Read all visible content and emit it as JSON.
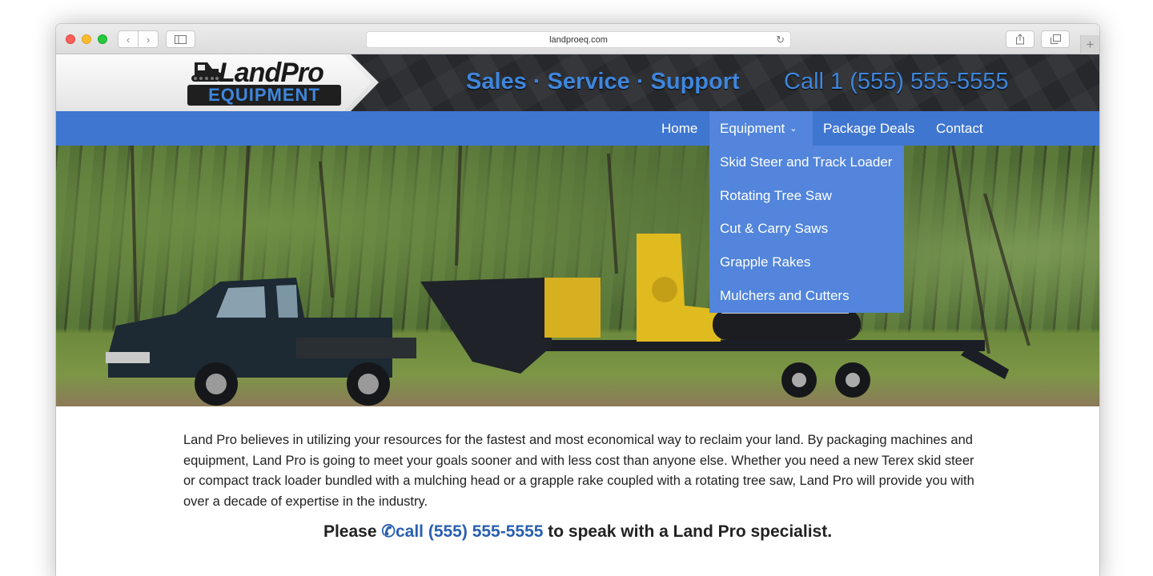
{
  "browser": {
    "url": "landproeq.com"
  },
  "header": {
    "logo_main": "LandPro",
    "logo_sub": "EQUIPMENT",
    "tagline": "Sales · Service · Support",
    "phone": "Call 1 (555) 555-5555"
  },
  "nav": {
    "items": [
      {
        "label": "Home"
      },
      {
        "label": "Equipment"
      },
      {
        "label": "Package Deals"
      },
      {
        "label": "Contact"
      }
    ],
    "dropdown": [
      {
        "label": "Skid Steer and Track Loader"
      },
      {
        "label": "Rotating Tree Saw"
      },
      {
        "label": "Cut & Carry Saws"
      },
      {
        "label": "Grapple Rakes"
      },
      {
        "label": "Mulchers and Cutters"
      }
    ]
  },
  "main": {
    "intro": "Land Pro believes in utilizing your resources for the fastest and most economical way to reclaim your land. By packaging machines and equipment, Land Pro is going to meet your goals sooner and with less cost than anyone else. Whether you need a new Terex skid steer or compact track loader bundled with a mulching head or a grapple rake coupled with a rotating tree saw, Land Pro will provide you with over a decade of expertise in the industry.",
    "cta_before": "Please ",
    "cta_link": "call (555) 555-5555",
    "cta_after": " to speak with a Land Pro specialist."
  },
  "colors": {
    "nav_blue": "#3f76d0",
    "dropdown_blue": "#5285db",
    "brand_blue": "#3f86dc",
    "header_dark": "#2a2c30"
  },
  "icons": [
    "back-icon",
    "forward-icon",
    "sidebar-icon",
    "reload-icon",
    "share-icon",
    "tabs-icon",
    "plus-icon",
    "phone-icon",
    "chevron-down-icon"
  ]
}
